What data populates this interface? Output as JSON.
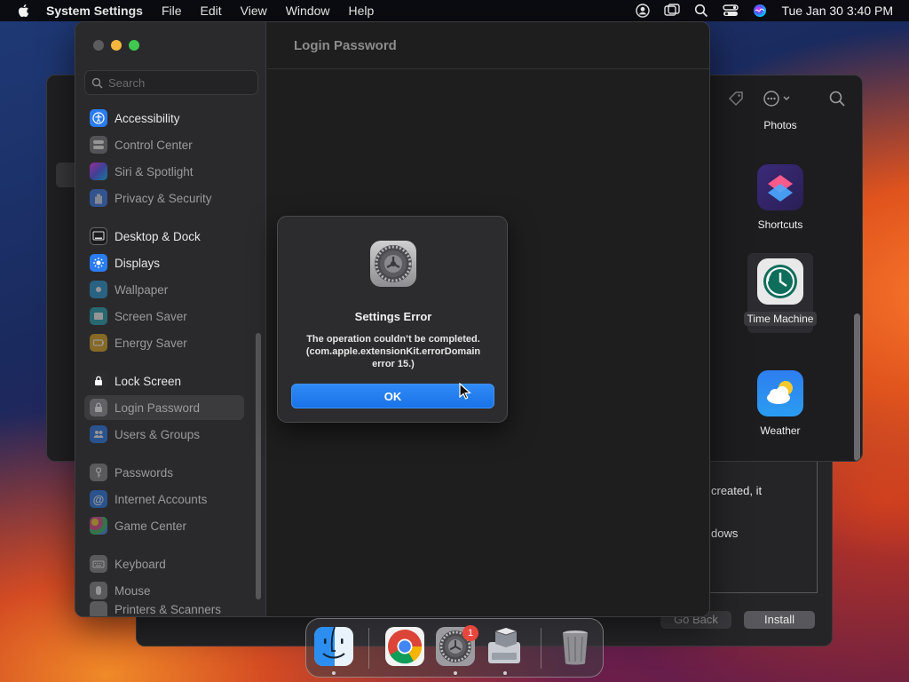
{
  "menubar": {
    "app_name": "System Settings",
    "items": [
      "File",
      "Edit",
      "View",
      "Window",
      "Help"
    ],
    "datetime": "Tue Jan 30  3:40 PM"
  },
  "background_window": {
    "apps": [
      {
        "label": "Photos",
        "icon": "photos-icon"
      },
      {
        "label": "Shortcuts",
        "icon": "shortcuts-icon"
      },
      {
        "label": "Time Machine",
        "icon": "time-machine-icon",
        "selected": true
      },
      {
        "label": "Weather",
        "icon": "weather-icon"
      }
    ]
  },
  "installer": {
    "text_line1": "created, it",
    "text_line2": "dows",
    "go_back": "Go Back",
    "install": "Install"
  },
  "settings": {
    "search_placeholder": "Search",
    "header_title": "Login Password",
    "sidebar": [
      {
        "label": "Accessibility",
        "color": "#2a7cf0",
        "dim": false
      },
      {
        "label": "Control Center",
        "color": "#7d7d82",
        "dim": false
      },
      {
        "label": "Siri & Spotlight",
        "color": "#b04fe0",
        "dim": false
      },
      {
        "label": "Privacy & Security",
        "color": "#3d7cf0",
        "dim": false
      },
      {
        "label": "Desktop & Dock",
        "color": "#1c1c1e",
        "dim": false
      },
      {
        "label": "Displays",
        "color": "#2a7cf0",
        "dim": false
      },
      {
        "label": "Wallpaper",
        "color": "#2a9bd8",
        "dim": true
      },
      {
        "label": "Screen Saver",
        "color": "#27a7b5",
        "dim": true
      },
      {
        "label": "Energy Saver",
        "color": "#e2a81d",
        "dim": true
      },
      {
        "label": "Lock Screen",
        "color": "#2c2c2e",
        "dim": false
      },
      {
        "label": "Login Password",
        "color": "#8a8a8e",
        "dim": true,
        "selected": true
      },
      {
        "label": "Users & Groups",
        "color": "#2a7cf0",
        "dim": false
      },
      {
        "label": "Passwords",
        "color": "#8a8a8e",
        "dim": true
      },
      {
        "label": "Internet Accounts",
        "color": "#2a7cf0",
        "dim": true
      },
      {
        "label": "Game Center",
        "color": "#e04e8f",
        "dim": false
      },
      {
        "label": "Keyboard",
        "color": "#8a8a8e",
        "dim": true
      },
      {
        "label": "Mouse",
        "color": "#8a8a8e",
        "dim": true
      },
      {
        "label": "Printers & Scanners",
        "color": "#8a8a8e",
        "dim": true
      }
    ]
  },
  "dialog": {
    "title": "Settings Error",
    "message": "The operation couldn’t be completed. (com.apple.extensionKit.errorDomain error 15.)",
    "ok_label": "OK"
  },
  "dock": {
    "items": [
      "finder-icon",
      "chrome-icon",
      "system-settings-icon",
      "installer-icon",
      "trash-icon"
    ],
    "badge": "1"
  }
}
